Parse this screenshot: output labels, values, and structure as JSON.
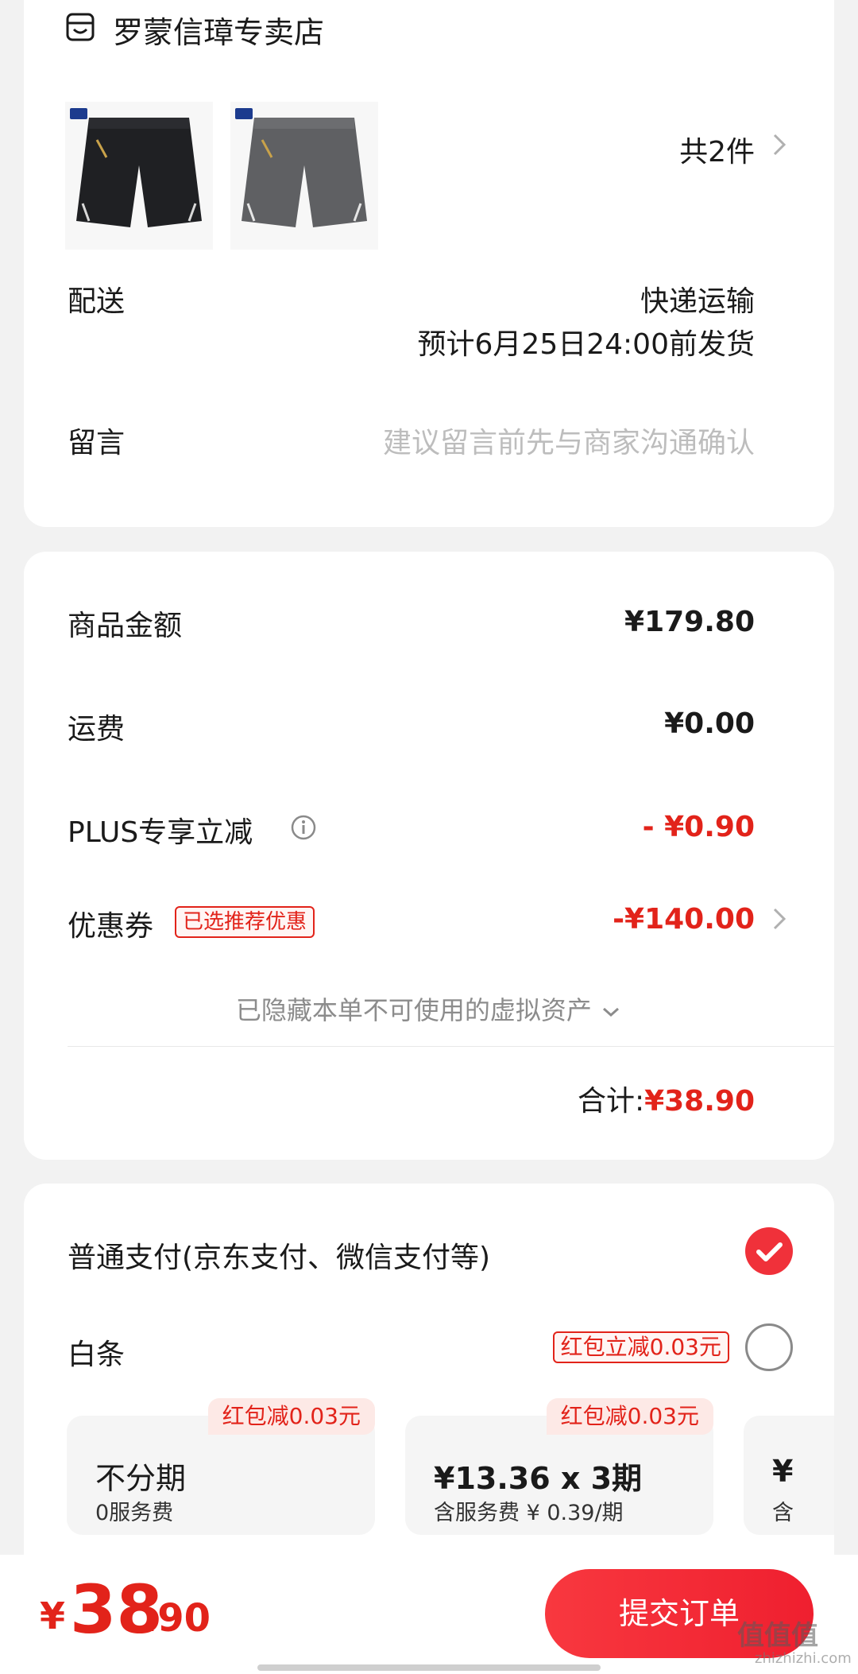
{
  "store": {
    "name": "罗蒙信璋专卖店",
    "item_count": "共2件",
    "products": [
      {
        "name": "black-shorts",
        "color": "#1f2023"
      },
      {
        "name": "gray-shorts",
        "color": "#5f6063"
      }
    ]
  },
  "delivery": {
    "label": "配送",
    "method": "快递运输",
    "eta": "预计6月25日24:00前发货"
  },
  "message": {
    "label": "留言",
    "placeholder": "建议留言前先与商家沟通确认"
  },
  "price": {
    "goods_label": "商品金额",
    "goods_value": "¥179.80",
    "shipping_label": "运费",
    "shipping_value": "¥0.00",
    "plus_label": "PLUS专享立减",
    "plus_value": "- ¥0.90",
    "coupon_label": "优惠券",
    "coupon_badge": "已选推荐优惠",
    "coupon_value": "-¥140.00",
    "hidden_assets": "已隐藏本单不可使用的虚拟资产",
    "total_label": "合计:",
    "total_value": "¥38.90"
  },
  "payment": {
    "normal_label": "普通支付(京东支付、微信支付等)",
    "baitiao_label": "白条",
    "baitiao_tag": "红包立减0.03元",
    "plans": [
      {
        "ribbon": "红包减0.03元",
        "title": "不分期",
        "sub": "0服务费"
      },
      {
        "ribbon": "红包减0.03元",
        "title": "¥13.36 x 3期",
        "sub": "含服务费 ¥ 0.39/期"
      },
      {
        "title": "¥",
        "sub": "含"
      }
    ]
  },
  "bottom": {
    "currency": "¥",
    "total_int": "38",
    "total_dec": ".90",
    "submit_label": "提交订单"
  },
  "watermark": {
    "text": "值值值",
    "sub": "zhizhizhi.com"
  },
  "colors": {
    "accent_red": "#e2231a",
    "button_red": "#f0313a"
  }
}
